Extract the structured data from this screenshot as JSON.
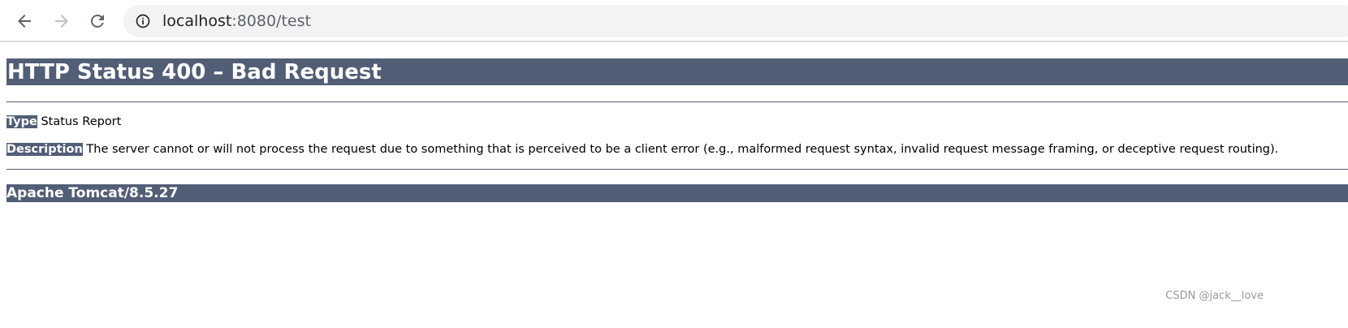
{
  "browser": {
    "url_host": "localhost",
    "url_rest": ":8080/test",
    "icons": {
      "back": "arrow-left-icon",
      "forward": "arrow-right-icon",
      "reload": "reload-icon",
      "site_info": "info-circle-icon"
    }
  },
  "page": {
    "title": "HTTP Status 400 – Bad Request",
    "type_label": "Type",
    "type_value": " Status Report",
    "description_label": "Description",
    "description_value": " The server cannot or will not process the request due to something that is perceived to be a client error (e.g., malformed request syntax, invalid request message framing, or deceptive request routing).",
    "server": "Apache Tomcat/8.5.27"
  },
  "watermark": "CSDN @jack__love",
  "colors": {
    "header_bg": "#525d76",
    "header_text": "#ffffff",
    "omnibox_bg": "#f1f3f4"
  }
}
